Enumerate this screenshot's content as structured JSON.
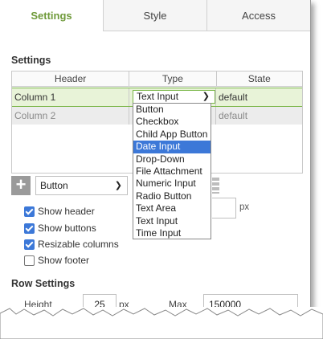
{
  "tabs": [
    {
      "label": "Settings",
      "active": true
    },
    {
      "label": "Style",
      "active": false
    },
    {
      "label": "Access",
      "active": false
    }
  ],
  "settings": {
    "title": "Settings",
    "grid": {
      "headers": [
        "Header",
        "Type",
        "State"
      ],
      "rows": [
        {
          "header": "Column 1",
          "type": "Text Input",
          "state": "default",
          "selected": true
        },
        {
          "header": "Column 2",
          "type": "",
          "state": "default",
          "selected": false
        }
      ]
    },
    "type_dropdown": {
      "options": [
        "Button",
        "Checkbox",
        "Child App Button",
        "Date Input",
        "Drop-Down",
        "File Attachment",
        "Numeric Input",
        "Radio Button",
        "Text Area",
        "Text Input",
        "Time Input"
      ],
      "highlighted": "Date Input"
    },
    "add_control": {
      "icon": "plus-icon",
      "selected": "Button"
    },
    "px_unit": "px",
    "checkboxes": [
      {
        "label": "Show header",
        "checked": true
      },
      {
        "label": "Show buttons",
        "checked": true
      },
      {
        "label": "Resizable columns",
        "checked": true
      },
      {
        "label": "Show footer",
        "checked": false
      }
    ]
  },
  "row_settings": {
    "title": "Row Settings",
    "height_label": "Height",
    "height_value": "25",
    "height_unit": "px",
    "max_label": "Max",
    "max_value": "150000"
  },
  "colors": {
    "accent": "#6f9a3a",
    "selection": "#3c78d8",
    "row_highlight": "#e8f3d8"
  }
}
